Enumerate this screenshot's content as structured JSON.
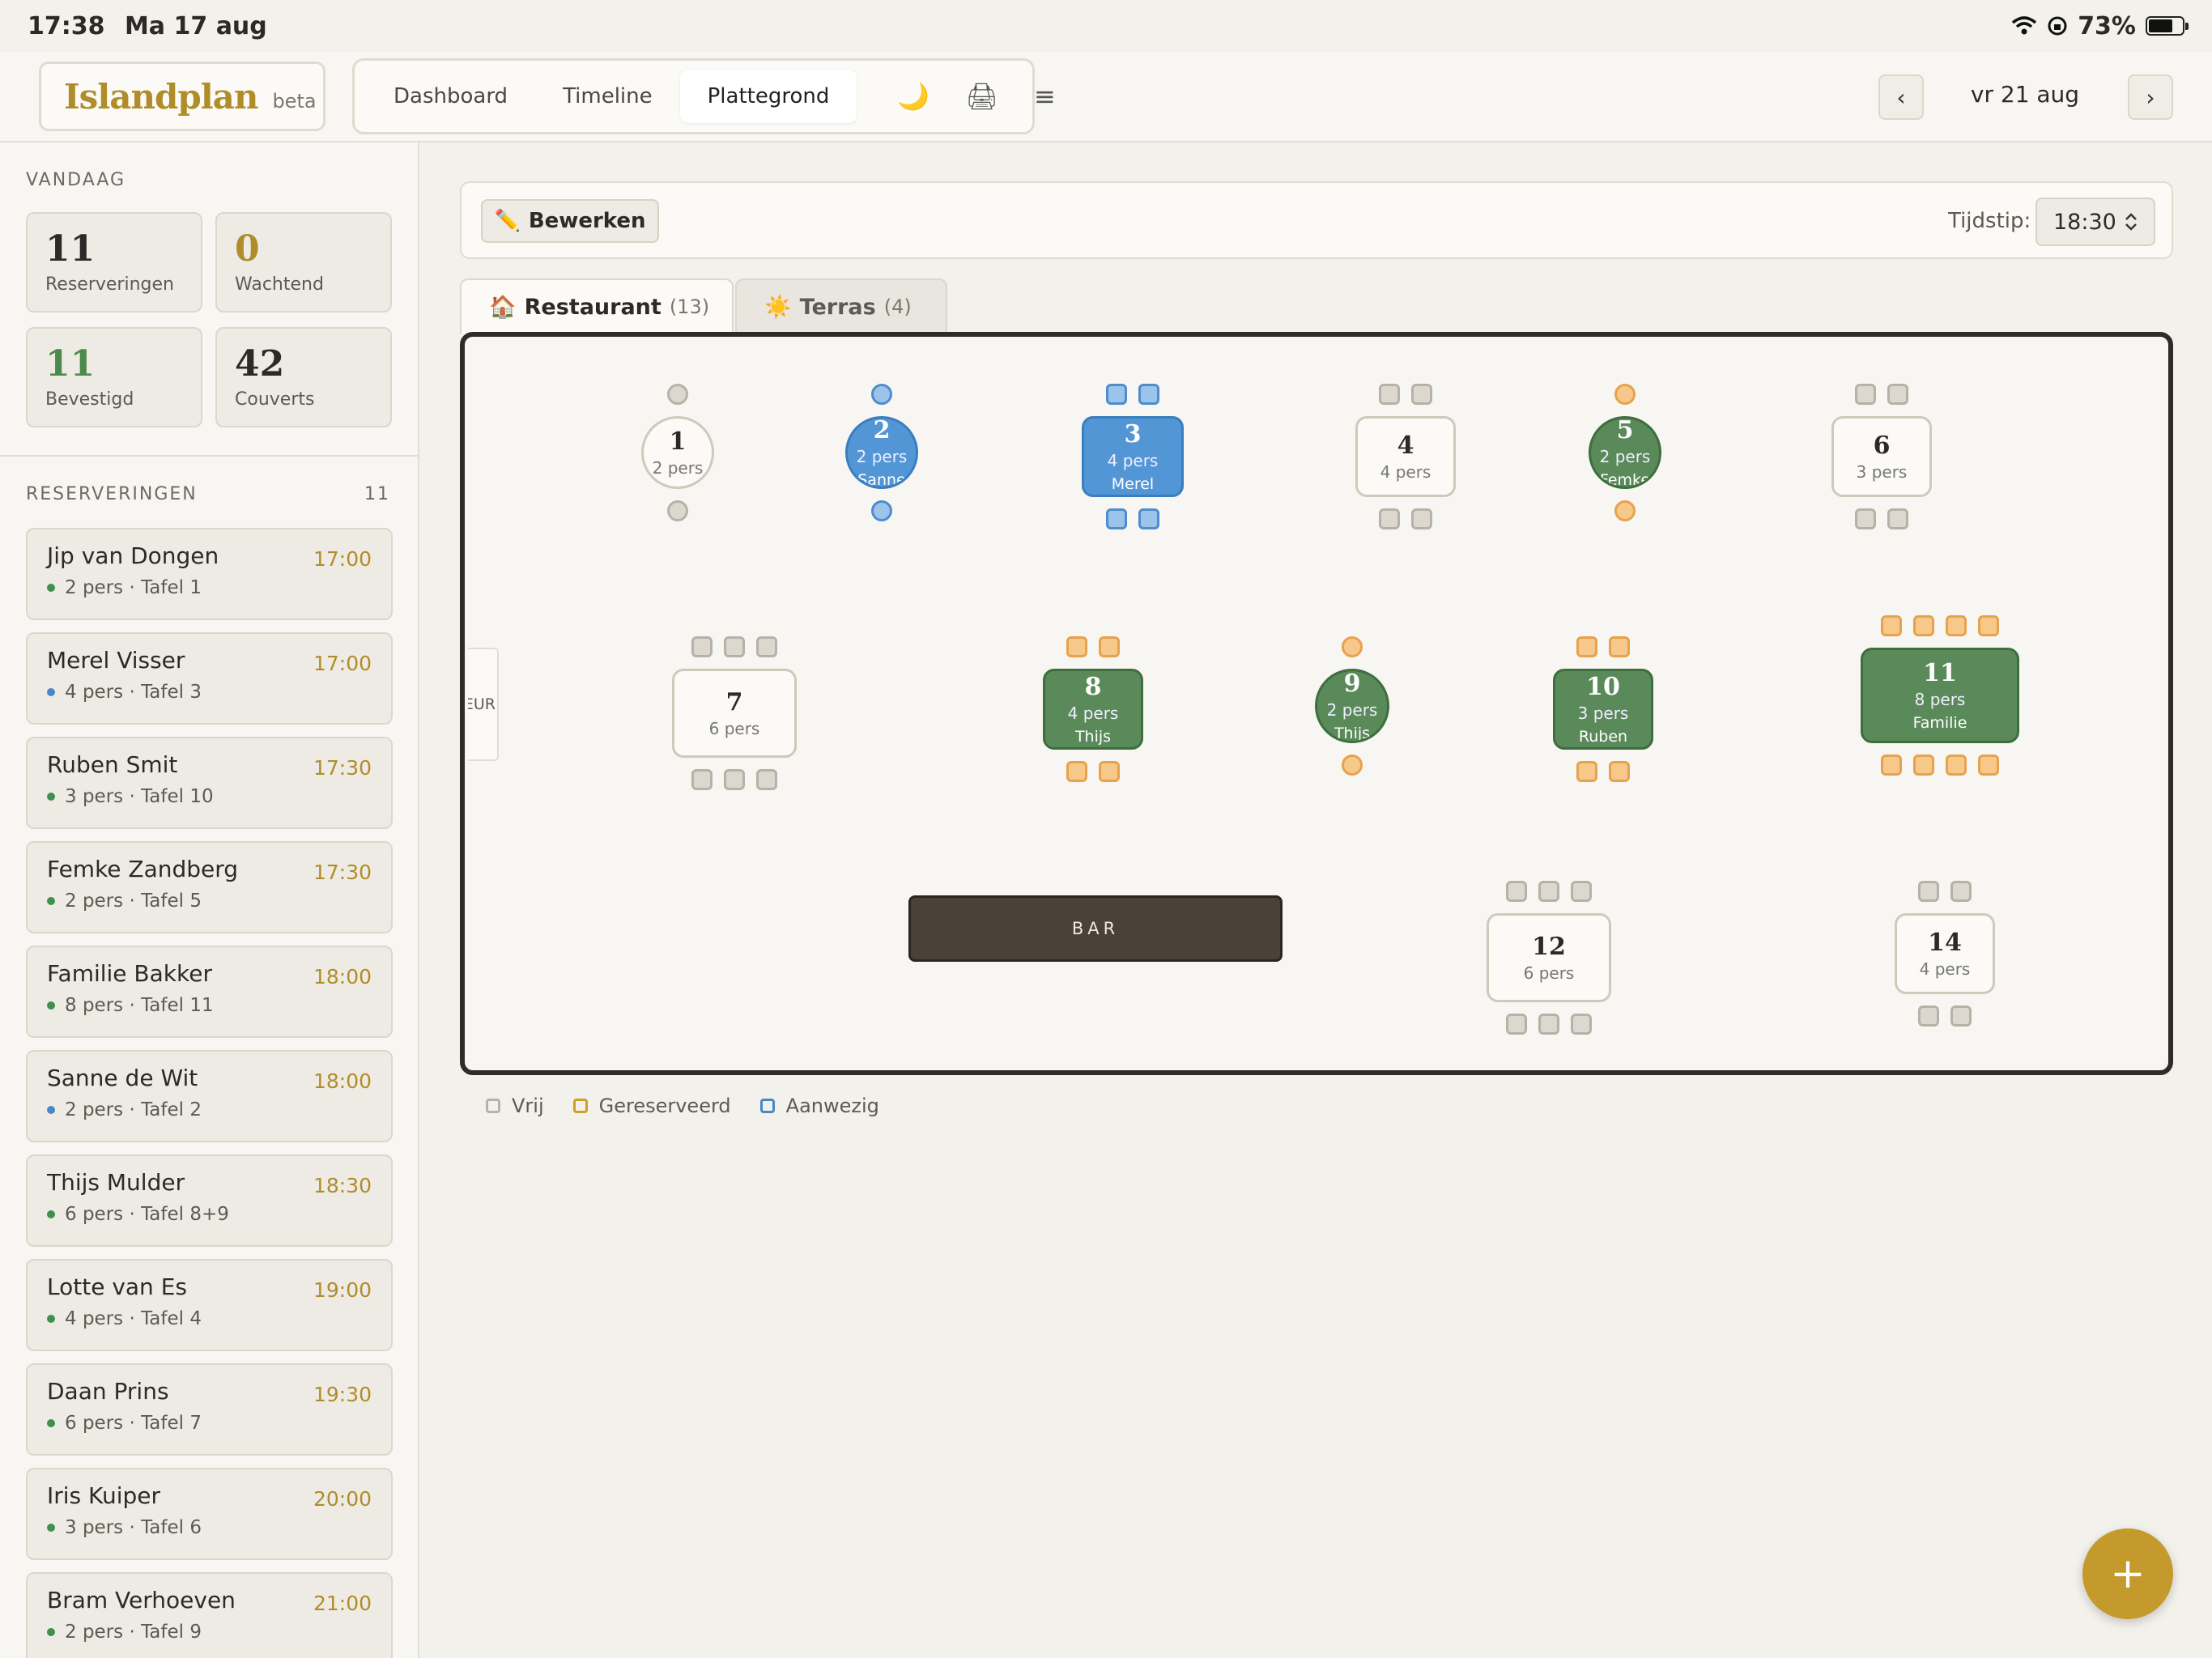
{
  "status": {
    "time": "17:38",
    "date": "Ma 17 aug",
    "battery": "73%"
  },
  "header": {
    "logo": "Islandplan",
    "beta": "beta",
    "nav": [
      "Dashboard",
      "Timeline",
      "Plattegrond"
    ],
    "icons": {
      "moon": "🌙",
      "print": "🖨",
      "menu": "≡"
    },
    "prev": "‹",
    "next": "›",
    "date": "vr 21 aug"
  },
  "sidebar": {
    "today_label": "VANDAAG",
    "stats": [
      {
        "num": "11",
        "label": "Reserveringen",
        "color": "#2b2a26"
      },
      {
        "num": "0",
        "label": "Wachtend",
        "color": "#b08d2a"
      },
      {
        "num": "11",
        "label": "Bevestigd",
        "color": "#4e8a4d"
      },
      {
        "num": "42",
        "label": "Couverts",
        "color": "#2b2a26"
      }
    ],
    "res_label": "RESERVERINGEN",
    "res_count": "11",
    "reservations": [
      {
        "name": "Jip van Dongen",
        "time": "17:00",
        "meta": "2 pers · Tafel 1",
        "dot": "#3f8f4e"
      },
      {
        "name": "Merel Visser",
        "time": "17:00",
        "meta": "4 pers · Tafel 3",
        "dot": "#4a86c8"
      },
      {
        "name": "Ruben Smit",
        "time": "17:30",
        "meta": "3 pers · Tafel 10",
        "dot": "#3f8f4e"
      },
      {
        "name": "Femke Zandberg",
        "time": "17:30",
        "meta": "2 pers · Tafel 5",
        "dot": "#3f8f4e"
      },
      {
        "name": "Familie Bakker",
        "time": "18:00",
        "meta": "8 pers · Tafel 11",
        "dot": "#3f8f4e"
      },
      {
        "name": "Sanne de Wit",
        "time": "18:00",
        "meta": "2 pers · Tafel 2",
        "dot": "#4a86c8"
      },
      {
        "name": "Thijs Mulder",
        "time": "18:30",
        "meta": "6 pers · Tafel 8+9",
        "dot": "#3f8f4e"
      },
      {
        "name": "Lotte van Es",
        "time": "19:00",
        "meta": "4 pers · Tafel 4",
        "dot": "#3f8f4e"
      },
      {
        "name": "Daan Prins",
        "time": "19:30",
        "meta": "6 pers · Tafel 7",
        "dot": "#3f8f4e"
      },
      {
        "name": "Iris Kuiper",
        "time": "20:00",
        "meta": "3 pers · Tafel 6",
        "dot": "#3f8f4e"
      },
      {
        "name": "Bram Verhoeven",
        "time": "21:00",
        "meta": "2 pers · Tafel 9",
        "dot": "#3f8f4e"
      }
    ]
  },
  "toolbar": {
    "edit_icon": "✏️",
    "edit": "Bewerken",
    "time_label": "Tijdstip:",
    "time_value": "18:30"
  },
  "areas": [
    {
      "icon": "🏠",
      "name": "Restaurant",
      "count": "(13)"
    },
    {
      "icon": "☀️",
      "name": "Terras",
      "count": "(4)"
    }
  ],
  "floor": {
    "door": "DEUR",
    "bar": "BAR",
    "tables": [
      {
        "num": "1",
        "pers": "2 pers",
        "guest": "",
        "status": "free"
      },
      {
        "num": "2",
        "pers": "2 pers",
        "guest": "Sanne",
        "status": "present"
      },
      {
        "num": "3",
        "pers": "4 pers",
        "guest": "Merel",
        "status": "present"
      },
      {
        "num": "4",
        "pers": "4 pers",
        "guest": "",
        "status": "free"
      },
      {
        "num": "5",
        "pers": "2 pers",
        "guest": "Femke",
        "status": "reserved"
      },
      {
        "num": "6",
        "pers": "3 pers",
        "guest": "",
        "status": "free"
      },
      {
        "num": "7",
        "pers": "6 pers",
        "guest": "",
        "status": "free"
      },
      {
        "num": "8",
        "pers": "4 pers",
        "guest": "Thijs",
        "status": "reserved"
      },
      {
        "num": "9",
        "pers": "2 pers",
        "guest": "Thijs",
        "status": "reserved"
      },
      {
        "num": "10",
        "pers": "3 pers",
        "guest": "Ruben",
        "status": "reserved"
      },
      {
        "num": "11",
        "pers": "8 pers",
        "guest": "Familie",
        "status": "reserved"
      },
      {
        "num": "12",
        "pers": "6 pers",
        "guest": "",
        "status": "free"
      },
      {
        "num": "14",
        "pers": "4 pers",
        "guest": "",
        "status": "free"
      }
    ]
  },
  "legend": [
    {
      "label": "Vrij",
      "color": "#b7b2a7"
    },
    {
      "label": "Gereserveerd",
      "color": "#c9a227"
    },
    {
      "label": "Aanwezig",
      "color": "#4a86c8"
    }
  ],
  "fab": "+"
}
